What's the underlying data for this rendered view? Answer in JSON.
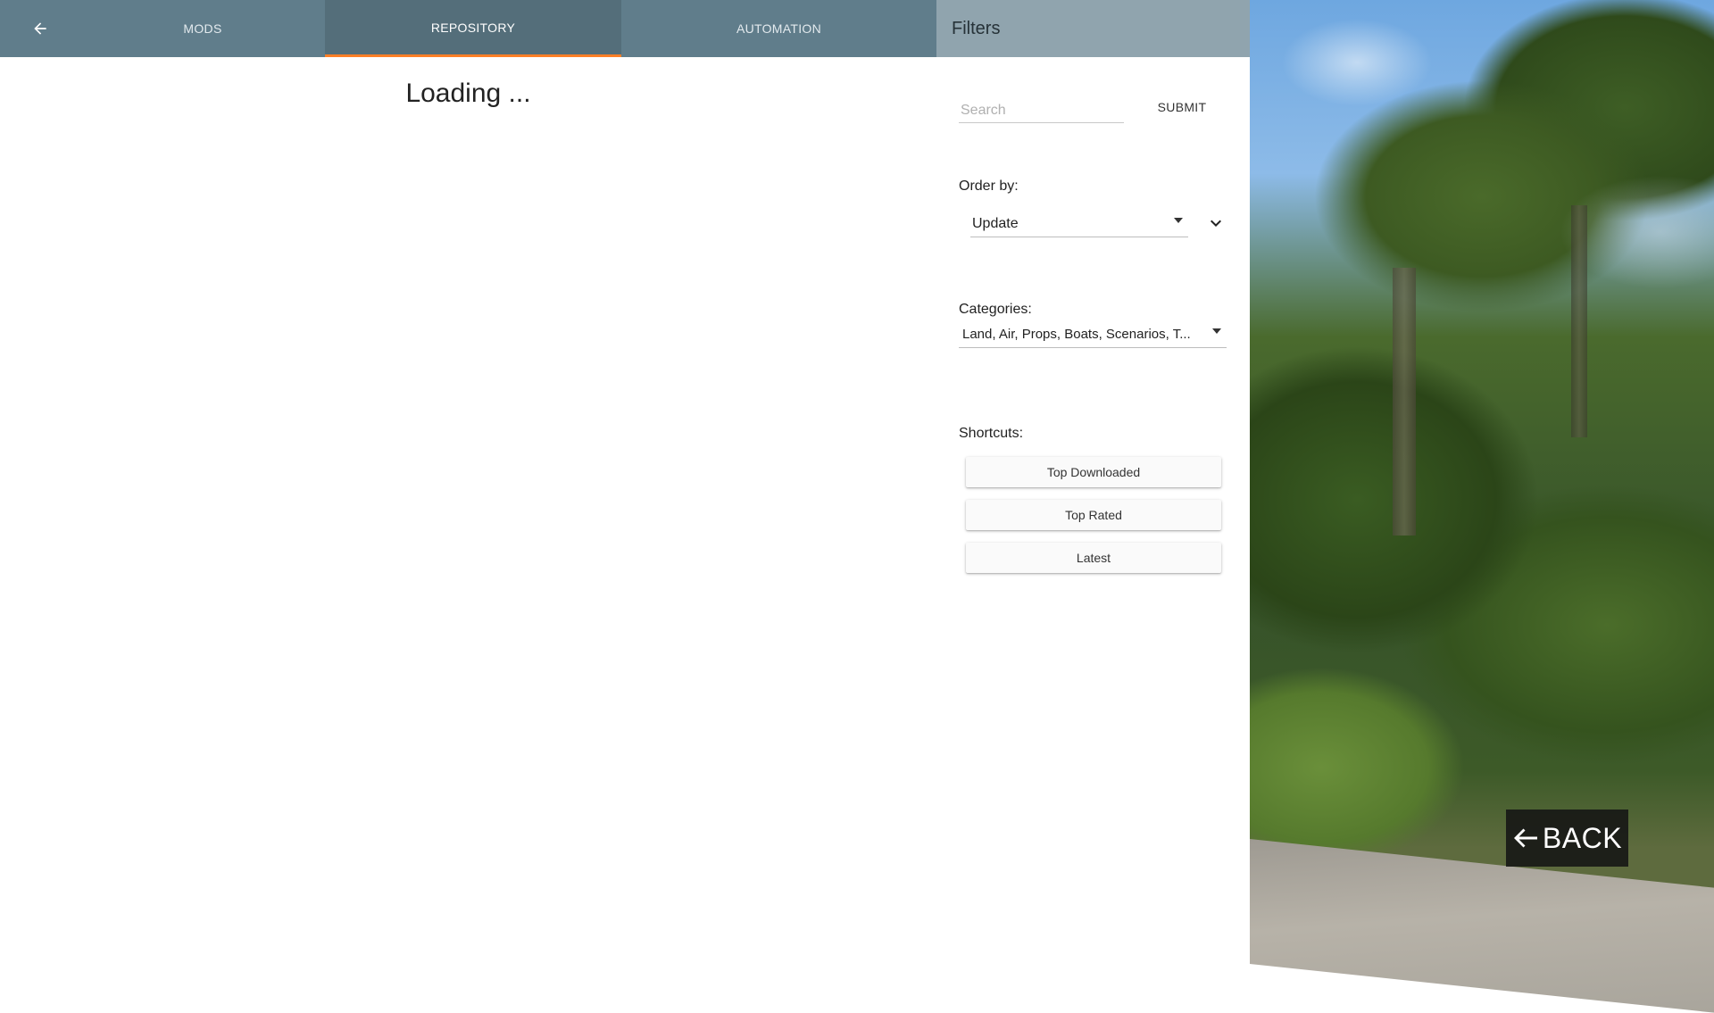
{
  "tabs": {
    "mods": "MODS",
    "repository": "REPOSITORY",
    "automation": "AUTOMATION"
  },
  "active_tab": "REPOSITORY",
  "filters": {
    "title": "Filters",
    "search_placeholder": "Search",
    "search_value": "",
    "submit_label": "SUBMIT",
    "order_by_label": "Order by:",
    "order_by_value": "Update",
    "categories_label": "Categories:",
    "categories_value": "Land, Air, Props, Boats, Scenarios, T...",
    "shortcuts_label": "Shortcuts:",
    "shortcuts": [
      "Top Downloaded",
      "Top Rated",
      "Latest"
    ]
  },
  "main": {
    "status": "Loading ..."
  },
  "overlay": {
    "back_label": "BACK"
  },
  "colors": {
    "tabbar": "#607d8b",
    "active_tab": "#546e7a",
    "active_indicator": "#ff7f27",
    "filters_header": "#90a4ae"
  },
  "icons": {
    "back": "arrow-left-icon",
    "order_direction": "chevron-down-icon",
    "dropdown": "caret-down-icon"
  }
}
